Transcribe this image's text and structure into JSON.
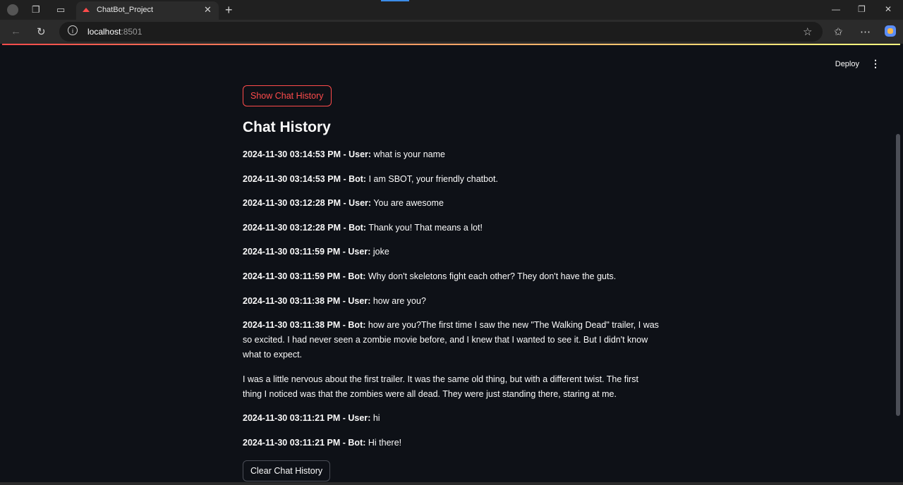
{
  "browser": {
    "tab_title": "ChatBot_Project",
    "url_host": "localhost",
    "url_port": ":8501"
  },
  "app": {
    "deploy_label": "Deploy",
    "show_history_label": "Show Chat History",
    "heading": "Chat History",
    "clear_history_label": "Clear Chat History",
    "messages": [
      {
        "meta": "2024-11-30 03:14:53 PM - User:",
        "text": "what is your name"
      },
      {
        "meta": "2024-11-30 03:14:53 PM - Bot:",
        "text": "I am SBOT, your friendly chatbot."
      },
      {
        "meta": "2024-11-30 03:12:28 PM - User:",
        "text": "You are awesome"
      },
      {
        "meta": "2024-11-30 03:12:28 PM - Bot:",
        "text": "Thank you! That means a lot!"
      },
      {
        "meta": "2024-11-30 03:11:59 PM - User:",
        "text": "joke"
      },
      {
        "meta": "2024-11-30 03:11:59 PM - Bot:",
        "text": "Why don't skeletons fight each other? They don't have the guts."
      },
      {
        "meta": "2024-11-30 03:11:38 PM - User:",
        "text": "how are you?"
      },
      {
        "meta": "2024-11-30 03:11:38 PM - Bot:",
        "text": "how are you?The first time I saw the new \"The Walking Dead\" trailer, I was so excited. I had never seen a zombie movie before, and I knew that I wanted to see it. But I didn't know what to expect."
      },
      {
        "meta": "",
        "text": "I was a little nervous about the first trailer. It was the same old thing, but with a different twist. The first thing I noticed was that the zombies were all dead. They were just standing there, staring at me."
      },
      {
        "meta": "2024-11-30 03:11:21 PM - User:",
        "text": "hi"
      },
      {
        "meta": "2024-11-30 03:11:21 PM - Bot:",
        "text": "Hi there!"
      }
    ]
  },
  "colors": {
    "accent": "#ff4b4b",
    "background": "#0e1117",
    "text": "#fafafa"
  }
}
